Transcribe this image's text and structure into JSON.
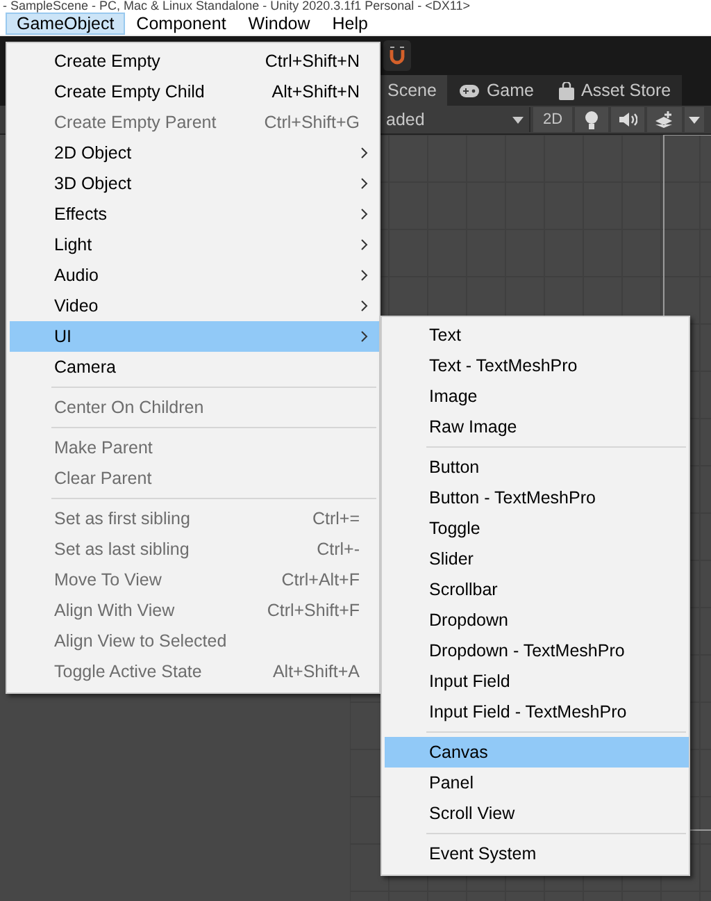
{
  "window": {
    "title": "- SampleScene - PC, Mac & Linux Standalone - Unity 2020.3.1f1 Personal - <DX11>"
  },
  "menubar": [
    {
      "label": "GameObject",
      "selected": true
    },
    {
      "label": "Component",
      "selected": false
    },
    {
      "label": "Window",
      "selected": false
    },
    {
      "label": "Help",
      "selected": false
    }
  ],
  "editor": {
    "tabs": [
      {
        "label": "Scene",
        "selected": true
      },
      {
        "label": "Game",
        "selected": false
      },
      {
        "label": "Asset Store",
        "selected": false
      }
    ],
    "shading_dropdown": "aded",
    "mode_button": "2D"
  },
  "menu": [
    {
      "kind": "item",
      "label": "Create Empty",
      "shortcut": "Ctrl+Shift+N",
      "disabled": false,
      "submenu": false,
      "selected": false
    },
    {
      "kind": "item",
      "label": "Create Empty Child",
      "shortcut": "Alt+Shift+N",
      "disabled": false,
      "submenu": false,
      "selected": false
    },
    {
      "kind": "item",
      "label": "Create Empty Parent",
      "shortcut": "Ctrl+Shift+G",
      "disabled": true,
      "submenu": false,
      "selected": false
    },
    {
      "kind": "item",
      "label": "2D Object",
      "disabled": false,
      "submenu": true,
      "selected": false
    },
    {
      "kind": "item",
      "label": "3D Object",
      "disabled": false,
      "submenu": true,
      "selected": false
    },
    {
      "kind": "item",
      "label": "Effects",
      "disabled": false,
      "submenu": true,
      "selected": false
    },
    {
      "kind": "item",
      "label": "Light",
      "disabled": false,
      "submenu": true,
      "selected": false
    },
    {
      "kind": "item",
      "label": "Audio",
      "disabled": false,
      "submenu": true,
      "selected": false
    },
    {
      "kind": "item",
      "label": "Video",
      "disabled": false,
      "submenu": true,
      "selected": false
    },
    {
      "kind": "item",
      "label": "UI",
      "disabled": false,
      "submenu": true,
      "selected": true
    },
    {
      "kind": "item",
      "label": "Camera",
      "disabled": false,
      "submenu": false,
      "selected": false
    },
    {
      "kind": "separator"
    },
    {
      "kind": "item",
      "label": "Center On Children",
      "disabled": true,
      "submenu": false,
      "selected": false
    },
    {
      "kind": "separator"
    },
    {
      "kind": "item",
      "label": "Make Parent",
      "disabled": true,
      "submenu": false,
      "selected": false
    },
    {
      "kind": "item",
      "label": "Clear Parent",
      "disabled": true,
      "submenu": false,
      "selected": false
    },
    {
      "kind": "separator"
    },
    {
      "kind": "item",
      "label": "Set as first sibling",
      "shortcut": "Ctrl+=",
      "disabled": true,
      "submenu": false,
      "selected": false
    },
    {
      "kind": "item",
      "label": "Set as last sibling",
      "shortcut": "Ctrl+-",
      "disabled": true,
      "submenu": false,
      "selected": false
    },
    {
      "kind": "item",
      "label": "Move To View",
      "shortcut": "Ctrl+Alt+F",
      "disabled": true,
      "submenu": false,
      "selected": false
    },
    {
      "kind": "item",
      "label": "Align With View",
      "shortcut": "Ctrl+Shift+F",
      "disabled": true,
      "submenu": false,
      "selected": false
    },
    {
      "kind": "item",
      "label": "Align View to Selected",
      "disabled": true,
      "submenu": false,
      "selected": false
    },
    {
      "kind": "item",
      "label": "Toggle Active State",
      "shortcut": "Alt+Shift+A",
      "disabled": true,
      "submenu": false,
      "selected": false
    }
  ],
  "submenu": [
    {
      "kind": "item",
      "label": "Text",
      "selected": false
    },
    {
      "kind": "item",
      "label": "Text - TextMeshPro",
      "selected": false
    },
    {
      "kind": "item",
      "label": "Image",
      "selected": false
    },
    {
      "kind": "item",
      "label": "Raw Image",
      "selected": false
    },
    {
      "kind": "separator"
    },
    {
      "kind": "item",
      "label": "Button",
      "selected": false
    },
    {
      "kind": "item",
      "label": "Button - TextMeshPro",
      "selected": false
    },
    {
      "kind": "item",
      "label": "Toggle",
      "selected": false
    },
    {
      "kind": "item",
      "label": "Slider",
      "selected": false
    },
    {
      "kind": "item",
      "label": "Scrollbar",
      "selected": false
    },
    {
      "kind": "item",
      "label": "Dropdown",
      "selected": false
    },
    {
      "kind": "item",
      "label": "Dropdown - TextMeshPro",
      "selected": false
    },
    {
      "kind": "item",
      "label": "Input Field",
      "selected": false
    },
    {
      "kind": "item",
      "label": "Input Field - TextMeshPro",
      "selected": false
    },
    {
      "kind": "separator"
    },
    {
      "kind": "item",
      "label": "Canvas",
      "selected": true
    },
    {
      "kind": "item",
      "label": "Panel",
      "selected": false
    },
    {
      "kind": "item",
      "label": "Scroll View",
      "selected": false
    },
    {
      "kind": "separator"
    },
    {
      "kind": "item",
      "label": "Event System",
      "selected": false
    }
  ]
}
